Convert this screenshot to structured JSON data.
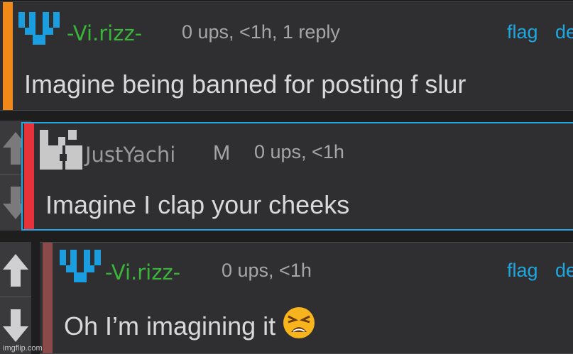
{
  "comments": [
    {
      "username": "-Vi.rizz-",
      "username_color": "#3ab43a",
      "meta": "0 ups, <1h, 1 reply",
      "flag": "flag",
      "delete": "de",
      "text": "Imagine being banned for posting f slur",
      "accent_color": "#f0891a"
    },
    {
      "username": "JustYachi",
      "badge": "M",
      "username_color": "#9a9a9c",
      "meta": "0 ups, <1h",
      "text": "Imagine I clap your cheeks",
      "accent_color": "#e8323a"
    },
    {
      "username": "-Vi.rizz-",
      "username_color": "#3ab43a",
      "meta": "0 ups, <1h",
      "flag": "flag",
      "delete": "de",
      "text": "Oh I’m imagining it",
      "emoji": "tired-face-emoji",
      "accent_color": "#8a4a4a"
    }
  ],
  "colors": {
    "link": "#1ea7e0",
    "highlight_border": "#1ea7e0",
    "avatar_blue": "#1a9ee0",
    "avatar_gray": "#c8c8c8"
  },
  "icons": [
    "upvote-arrow-icon",
    "downvote-arrow-icon"
  ],
  "watermark": "imgflip.com"
}
